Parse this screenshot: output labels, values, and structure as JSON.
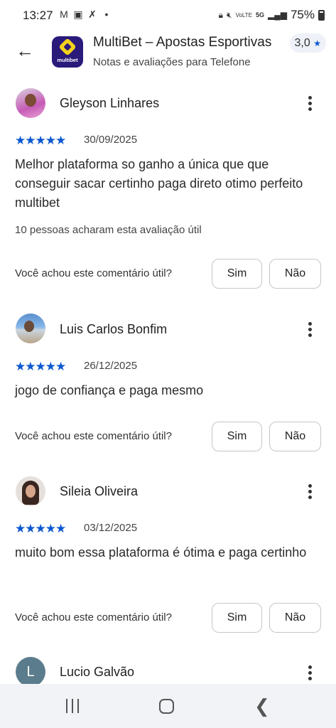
{
  "status_bar": {
    "time": "13:27",
    "left_icons": [
      "gmail-icon",
      "gallery-icon",
      "missed-call-icon",
      "dot-icon"
    ],
    "right_icons": [
      "lock-icon",
      "mute-icon",
      "volte-icon",
      "5g-icon",
      "signal-icon"
    ],
    "volte_label": "VoLTE",
    "network_label": "5G",
    "battery_percent": "75%",
    "battery_level": 0.75
  },
  "header": {
    "back_icon": "arrow-back-icon",
    "app_brand": "multibet",
    "app_title": "MultiBet – Apostas Esportivas",
    "subtitle": "Notas e avaliações para Telefone",
    "rating": "3,0",
    "rating_icon": "star-icon"
  },
  "reviews": [
    {
      "name": "Gleyson Linhares",
      "stars": "★★★★★",
      "rating": 5,
      "date": "30/09/2025",
      "text": "Melhor plataforma so ganho a única que que conseguir sacar certinho paga direto otimo perfeito multibet",
      "helpful_count": "10 pessoas acharam esta avaliação útil",
      "helpful_question": "Você achou este comentário útil?",
      "yes_label": "Sim",
      "no_label": "Não"
    },
    {
      "name": "Luis Carlos Bonfim",
      "stars": "★★★★★",
      "rating": 5,
      "date": "26/12/2025",
      "text": "jogo de confiança e paga mesmo",
      "helpful_question": "Você achou este comentário útil?",
      "yes_label": "Sim",
      "no_label": "Não"
    },
    {
      "name": "Sileia Oliveira",
      "stars": "★★★★★",
      "rating": 5,
      "date": "03/12/2025",
      "text": "muito bom essa plataforma é ótima e paga certinho",
      "helpful_question": "Você achou este comentário útil?",
      "yes_label": "Sim",
      "no_label": "Não"
    },
    {
      "name": "Lucio Galvão",
      "avatar_letter": "L"
    }
  ],
  "nav_bar": {
    "icons": [
      "recents-icon",
      "home-icon",
      "back-icon"
    ]
  },
  "colors": {
    "accent": "#0b57d0",
    "app_icon_bg": "#2a1a7a",
    "app_icon_mark": "#f3d21c",
    "nav_bg": "#f1f3f6"
  }
}
